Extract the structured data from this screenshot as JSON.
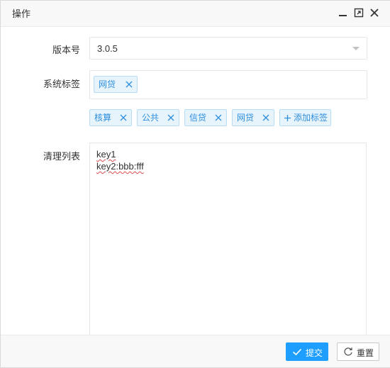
{
  "dialog": {
    "title": "操作",
    "icons": [
      "minimize-icon",
      "maximize-icon",
      "close-icon"
    ]
  },
  "form": {
    "version": {
      "label": "版本号",
      "value": "3.0.5"
    },
    "system_tags": {
      "label": "系统标签",
      "selected": [
        {
          "label": "网贷"
        }
      ]
    },
    "available_tags": [
      {
        "label": "核算"
      },
      {
        "label": "公共"
      },
      {
        "label": "信贷"
      },
      {
        "label": "网贷"
      }
    ],
    "add_tag_label": "添加标签",
    "clear_list": {
      "label": "清理列表",
      "lines": [
        "key1",
        "key2:bbb:fff"
      ]
    }
  },
  "footer": {
    "submit_label": "提交",
    "reset_label": "重置"
  },
  "colors": {
    "primary": "#1e9fff",
    "tag_text": "#2f8fde",
    "tag_bg": "#e8f4fc"
  }
}
